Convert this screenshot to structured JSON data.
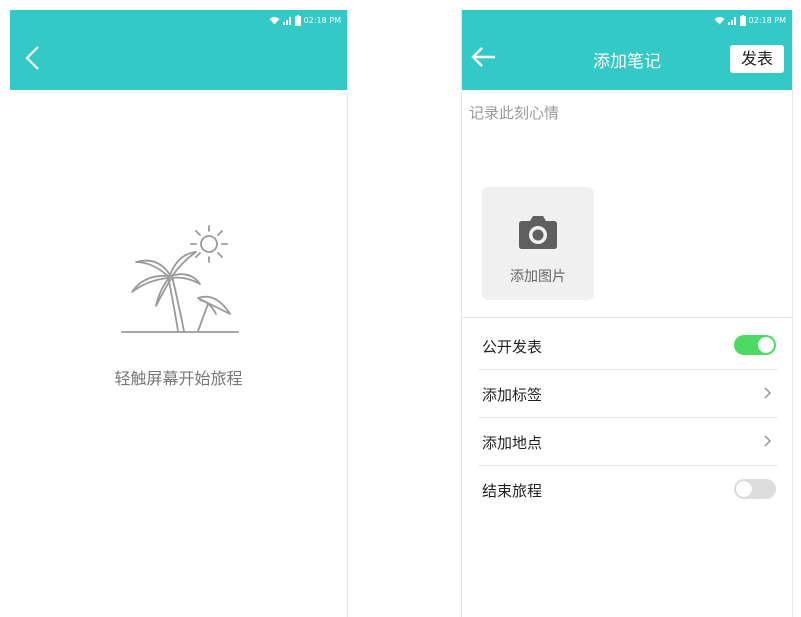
{
  "status_bar": {
    "time": "02:18 PM",
    "icons": [
      "wifi-icon",
      "signal-icon",
      "battery-icon"
    ]
  },
  "left_screen": {
    "back_icon": "chevron-left-icon",
    "empty_hint": "轻触屏幕开始旅程",
    "illustration": "beach-palm-tree-icon"
  },
  "right_screen": {
    "back_icon": "arrow-left-icon",
    "title": "添加笔记",
    "publish_label": "发表",
    "note_placeholder": "记录此刻心情",
    "add_photo_label": "添加图片",
    "camera_icon": "camera-icon",
    "settings": [
      {
        "label": "公开发表",
        "control": "toggle",
        "on": true
      },
      {
        "label": "添加标签",
        "control": "chevron"
      },
      {
        "label": "添加地点",
        "control": "chevron"
      },
      {
        "label": "结束旅程",
        "control": "toggle",
        "on": false
      }
    ]
  },
  "colors": {
    "accent": "#33c9c6",
    "toggle_on": "#4cd964",
    "toggle_off": "#dddddd",
    "text_primary": "#222222",
    "text_hint": "#999999"
  }
}
